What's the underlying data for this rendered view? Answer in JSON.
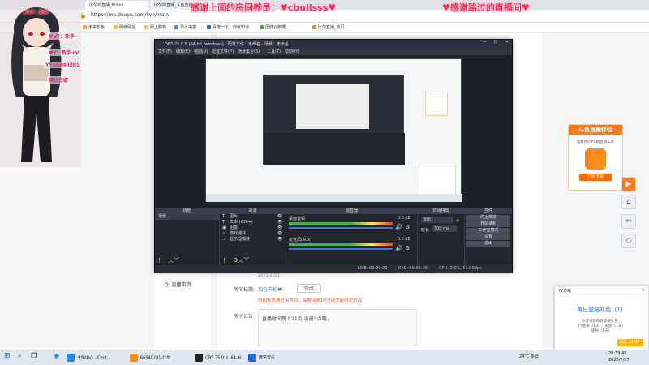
{
  "browser": {
    "tabs": [
      "比尔的直播_Bilibili",
      "比尔的直播_斗鱼直播..."
    ],
    "url": "https://mp.douyu.com/live/main",
    "bookmarks": [
      "未来影板",
      "网络网址",
      "网上购物",
      "导入书签",
      "百度一下，你就知道",
      "国健云数据...",
      "比尔直播_热门..."
    ]
  },
  "overlay": {
    "top_center": "感谢上面的房间养员：♥cbullsss♥",
    "top_right": "♥感谢路过的直播间♥",
    "left_text1": "♥VT：新手",
    "left_text2": "♥Y：新手+V",
    "left_text3": "YY66840281",
    "left_text4": "禁止白嫖"
  },
  "obs": {
    "title": "OBS 25.0.8 (64-bit, windows) - 配置文件：未命名 - 场景：未命名",
    "menu": [
      "文件(F)",
      "编辑(E)",
      "视图(V)",
      "配置文件(P)",
      "场景集合(S)",
      "工具(T)",
      "帮助(H)"
    ],
    "docks": {
      "scenes_title": "场景",
      "sources_title": "来源",
      "mixer_title": "混音器",
      "transition_title": "转场特效",
      "controls_title": "控件",
      "scenes": [
        "场景"
      ],
      "sources": [
        "图片",
        "文本 (GDI+)",
        "图像",
        "游戏捕获",
        "显示器捕获"
      ],
      "mixer": [
        {
          "name": "桌面音频",
          "db": "0.0 dB"
        },
        {
          "name": "麦克风/Aux",
          "db": "0.0 dB"
        }
      ],
      "transition": {
        "type": "淡出",
        "duration_label": "时长",
        "duration": "300 ms"
      },
      "controls": [
        "停止推流",
        "开始录制",
        "工作室模式",
        "设置",
        "退出"
      ]
    },
    "status": {
      "live": "LIVE: 00:00:00",
      "rec": "REC: 00:00:00",
      "cpu": "CPU: 0.6%, 60.00 fps"
    }
  },
  "page": {
    "sidebar_item": "直播带货",
    "room_label": "房间标题:",
    "room_title": "加仑丰稻♥",
    "edit_button": "修改",
    "title_warning": "房间标题通过审核后，需要间隔10分钟才能再次修改",
    "notice_label": "房间公告:",
    "notice_text": "直播时间晚上21点-凌晨3点哦。",
    "date": "2021-2021"
  },
  "promo": {
    "title": "斗鱼直播伴侣",
    "desc": "超好用的PC端直播工具",
    "button": "立即下载"
  },
  "yy": {
    "header": "YY游戏",
    "title": "每日登陆礼包（1）",
    "body": "你可领取每日登录礼包：\nYY金质（1天）、皮肤（1天）\n座驾（1天）",
    "button": "领取（1/1）"
  },
  "taskbar": {
    "items": [
      "主播中心 - Cent...",
      "66540281-比尔",
      "OBS 25.0.8 (64-bi...",
      "腾讯音乐"
    ],
    "weather": "24°C 多云",
    "time": "20:39:48",
    "date": "2022/7/27"
  }
}
